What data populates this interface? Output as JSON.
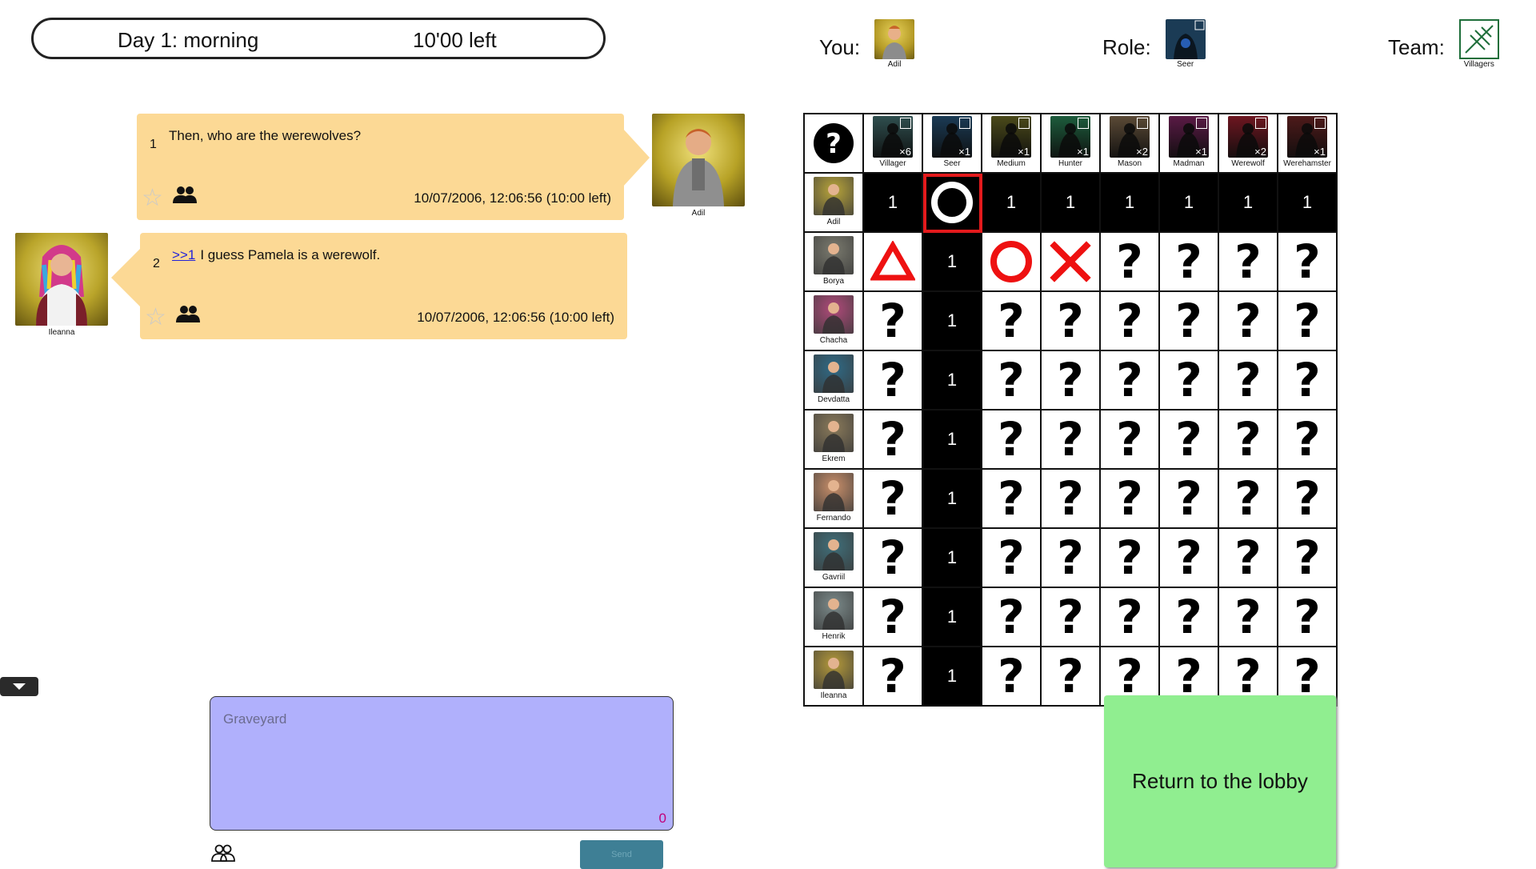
{
  "header": {
    "phase": "Day 1: morning",
    "time_left": "10'00 left"
  },
  "you": {
    "label": "You:",
    "name": "Adil"
  },
  "role": {
    "label": "Role:",
    "name": "Seer"
  },
  "team": {
    "label": "Team:",
    "name": "Villagers"
  },
  "messages": [
    {
      "num": "1",
      "reply": "",
      "text": "Then, who are the werewolves?",
      "timestamp": "10/07/2006, 12:06:56 (10:00 left)",
      "author": "Adil"
    },
    {
      "num": "2",
      "reply": ">>1",
      "text": "I guess Pamela is a werewolf.",
      "timestamp": "10/07/2006, 12:06:56 (10:00 left)",
      "author": "Ileanna"
    }
  ],
  "input": {
    "placeholder": "Graveyard",
    "char_count": "0",
    "send_label": "Send"
  },
  "lobby_button": "Return to the lobby",
  "roles": [
    {
      "name": "Villager",
      "count": "×6",
      "color": "#2f4f4f"
    },
    {
      "name": "Seer",
      "count": "×1",
      "color": "#1b3b55"
    },
    {
      "name": "Medium",
      "count": "×1",
      "color": "#4b4a1a"
    },
    {
      "name": "Hunter",
      "count": "×1",
      "color": "#1d5c3c"
    },
    {
      "name": "Mason",
      "count": "×2",
      "color": "#5b4a36"
    },
    {
      "name": "Madman",
      "count": "×1",
      "color": "#5a1a45"
    },
    {
      "name": "Werewolf",
      "count": "×2",
      "color": "#6e1620"
    },
    {
      "name": "Werehamster",
      "count": "×1",
      "color": "#4e1a1a"
    }
  ],
  "players": [
    {
      "name": "Adil",
      "color": "#b9a53a",
      "cells": [
        "1",
        "O",
        "1",
        "1",
        "1",
        "1",
        "1",
        "1"
      ],
      "row_black": true
    },
    {
      "name": "Borya",
      "color": "#7a7a6e",
      "cells": [
        "triangle",
        "1",
        "circle",
        "cross",
        "?",
        "?",
        "?",
        "?"
      ]
    },
    {
      "name": "Chacha",
      "color": "#b04a7a",
      "cells": [
        "?",
        "1",
        "?",
        "?",
        "?",
        "?",
        "?",
        "?"
      ]
    },
    {
      "name": "Devdatta",
      "color": "#2f6a86",
      "cells": [
        "?",
        "1",
        "?",
        "?",
        "?",
        "?",
        "?",
        "?"
      ]
    },
    {
      "name": "Ekrem",
      "color": "#8a7a5a",
      "cells": [
        "?",
        "1",
        "?",
        "?",
        "?",
        "?",
        "?",
        "?"
      ]
    },
    {
      "name": "Fernando",
      "color": "#c98f6a",
      "cells": [
        "?",
        "1",
        "?",
        "?",
        "?",
        "?",
        "?",
        "?"
      ]
    },
    {
      "name": "Gavriil",
      "color": "#3f6f7a",
      "cells": [
        "?",
        "1",
        "?",
        "?",
        "?",
        "?",
        "?",
        "?"
      ]
    },
    {
      "name": "Henrik",
      "color": "#7b8a8a",
      "cells": [
        "?",
        "1",
        "?",
        "?",
        "?",
        "?",
        "?",
        "?"
      ]
    },
    {
      "name": "Ileanna",
      "color": "#b59a3a",
      "cells": [
        "?",
        "1",
        "?",
        "?",
        "?",
        "?",
        "?",
        "?"
      ]
    }
  ],
  "icons": {
    "unknown": "question-circle-icon",
    "people": "people-icon",
    "star": "star-icon",
    "collapse": "chevron-down-icon"
  }
}
